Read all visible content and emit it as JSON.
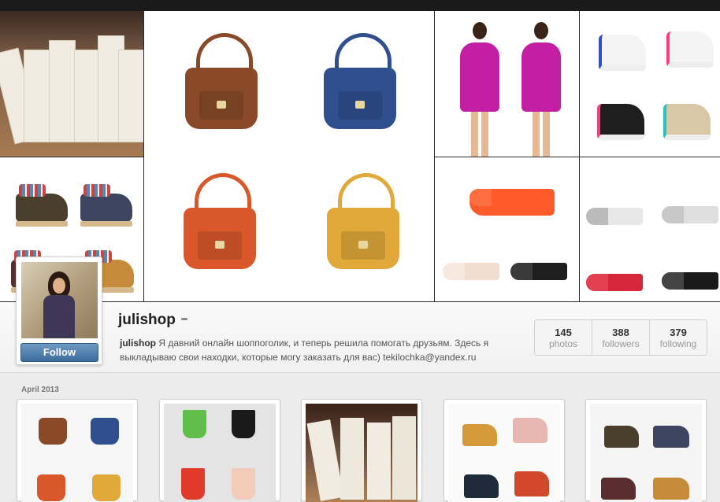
{
  "profile": {
    "username": "julishop",
    "bio_user": "julishop",
    "bio_text": " Я давний онлайн шоппоголик, и теперь решила помогать друзьям. Здесь я выкладываю свои находки, которые могу заказать для вас) tekilochka@yandex.ru",
    "follow_label": "Follow"
  },
  "stats": [
    {
      "value": "145",
      "label": "photos"
    },
    {
      "value": "388",
      "label": "followers"
    },
    {
      "value": "379",
      "label": "following"
    }
  ],
  "feed": {
    "month_label": "April 2013"
  },
  "colors": {
    "follow_button": "#3d6c9c",
    "topbar": "#1a1a1a",
    "bag_brown": "#8a4a2a",
    "bag_blue": "#2f4f8f",
    "bag_orange": "#d9572a",
    "bag_yellow": "#e0a93a"
  }
}
